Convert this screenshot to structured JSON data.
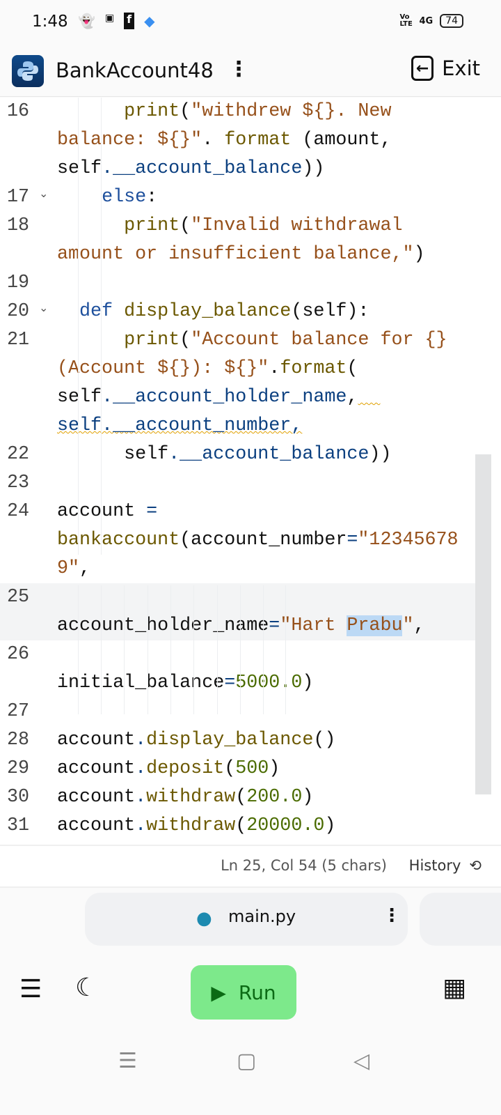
{
  "status_bar": {
    "time": "1:48",
    "battery": "74",
    "network": "4G",
    "volte": "Vo LTE"
  },
  "header": {
    "title": "BankAccount48",
    "exit_label": "Exit"
  },
  "code_rows": [
    {
      "num": "16",
      "fold": false,
      "tokens": [
        [
          "      ",
          ""
        ],
        [
          "print",
          "fn"
        ],
        [
          "(",
          ""
        ],
        [
          "\"withdrew ${}. New",
          "str"
        ]
      ]
    },
    {
      "num": "",
      "fold": false,
      "tokens": [
        [
          "balance: ${}\"",
          "str"
        ],
        [
          ". ",
          ""
        ],
        [
          "format",
          "fn"
        ],
        [
          " (amount,",
          ""
        ]
      ]
    },
    {
      "num": "",
      "fold": false,
      "tokens": [
        [
          "self",
          ""
        ],
        [
          ".__account_balance",
          "attr"
        ],
        [
          "))",
          ""
        ]
      ]
    },
    {
      "num": "17",
      "fold": true,
      "tokens": [
        [
          "    ",
          ""
        ],
        [
          "else",
          "kw"
        ],
        [
          ":",
          ""
        ]
      ]
    },
    {
      "num": "18",
      "fold": false,
      "tokens": [
        [
          "      ",
          ""
        ],
        [
          "print",
          "fn"
        ],
        [
          "(",
          ""
        ],
        [
          "\"Invalid withdrawal",
          "str"
        ]
      ]
    },
    {
      "num": "",
      "fold": false,
      "tokens": [
        [
          "amount or insufficient balance,\"",
          "str"
        ],
        [
          ")",
          ""
        ]
      ]
    },
    {
      "num": "19",
      "fold": false,
      "tokens": []
    },
    {
      "num": "20",
      "fold": true,
      "tokens": [
        [
          "  ",
          ""
        ],
        [
          "def",
          "kw"
        ],
        [
          " ",
          ""
        ],
        [
          "display_balance",
          "fn"
        ],
        [
          "(self):",
          ""
        ]
      ]
    },
    {
      "num": "21",
      "fold": false,
      "tokens": [
        [
          "      ",
          ""
        ],
        [
          "print",
          "fn"
        ],
        [
          "(",
          ""
        ],
        [
          "\"Account balance for {}",
          "str"
        ]
      ]
    },
    {
      "num": "",
      "fold": false,
      "tokens": [
        [
          "(Account ${}): ${}\"",
          "str"
        ],
        [
          ".",
          ""
        ],
        [
          "format",
          "fn"
        ],
        [
          "(",
          ""
        ]
      ]
    },
    {
      "num": "",
      "fold": false,
      "tokens": [
        [
          "self",
          ""
        ],
        [
          ".__account_holder_name",
          "attr"
        ],
        [
          ",",
          ""
        ],
        [
          "  ",
          "sq"
        ]
      ]
    },
    {
      "num": "",
      "fold": false,
      "tokens": [
        [
          "self.__account_number,",
          "sq attr"
        ]
      ]
    },
    {
      "num": "22",
      "fold": false,
      "tokens": [
        [
          "      ",
          ""
        ],
        [
          "self",
          ""
        ],
        [
          ".__account_balance",
          "attr"
        ],
        [
          "))",
          ""
        ]
      ]
    },
    {
      "num": "23",
      "fold": false,
      "tokens": []
    },
    {
      "num": "24",
      "fold": false,
      "tokens": [
        [
          "account ",
          ""
        ],
        [
          "=",
          "attr"
        ]
      ]
    },
    {
      "num": "",
      "fold": false,
      "tokens": [
        [
          "bankaccount",
          "fn"
        ],
        [
          "(account_number",
          ""
        ],
        [
          "=",
          "attr"
        ],
        [
          "\"12345678",
          "str"
        ]
      ]
    },
    {
      "num": "",
      "fold": false,
      "tokens": [
        [
          "9\"",
          "str"
        ],
        [
          ",",
          ""
        ]
      ]
    },
    {
      "num": "25",
      "fold": false,
      "hl": true,
      "tokens": []
    },
    {
      "num": "",
      "fold": false,
      "hl": true,
      "tokens": [
        [
          "account_holder_name",
          ""
        ],
        [
          "=",
          "attr"
        ],
        [
          "\"Hart ",
          "str"
        ],
        [
          "Prabu",
          "str sel"
        ],
        [
          "\"",
          "str"
        ],
        [
          ",",
          ""
        ]
      ]
    },
    {
      "num": "26",
      "fold": false,
      "tokens": []
    },
    {
      "num": "",
      "fold": false,
      "tokens": [
        [
          "initial_balance",
          ""
        ],
        [
          "=",
          "attr"
        ],
        [
          "5000.0",
          "num"
        ],
        [
          ")",
          ""
        ]
      ]
    },
    {
      "num": "27",
      "fold": false,
      "tokens": []
    },
    {
      "num": "28",
      "fold": false,
      "tokens": [
        [
          "account",
          ""
        ],
        [
          ".",
          "attr"
        ],
        [
          "display_balance",
          "fn"
        ],
        [
          "()",
          ""
        ]
      ]
    },
    {
      "num": "29",
      "fold": false,
      "tokens": [
        [
          "account",
          ""
        ],
        [
          ".",
          "attr"
        ],
        [
          "deposit",
          "fn"
        ],
        [
          "(",
          ""
        ],
        [
          "500",
          "num"
        ],
        [
          ")",
          ""
        ]
      ]
    },
    {
      "num": "30",
      "fold": false,
      "tokens": [
        [
          "account",
          ""
        ],
        [
          ".",
          "attr"
        ],
        [
          "withdraw",
          "fn"
        ],
        [
          "(",
          ""
        ],
        [
          "200.0",
          "num"
        ],
        [
          ")",
          ""
        ]
      ]
    },
    {
      "num": "31",
      "fold": false,
      "tokens": [
        [
          "account",
          ""
        ],
        [
          ".",
          "attr"
        ],
        [
          "withdraw",
          "fn"
        ],
        [
          "(",
          ""
        ],
        [
          "20000.0",
          "num"
        ],
        [
          ")",
          ""
        ]
      ]
    }
  ],
  "editor_status": {
    "position": "Ln 25, Col 54 (5 chars)",
    "history_label": "History"
  },
  "file_tab": {
    "name": "main.py"
  },
  "toolbar": {
    "run_label": "Run"
  }
}
